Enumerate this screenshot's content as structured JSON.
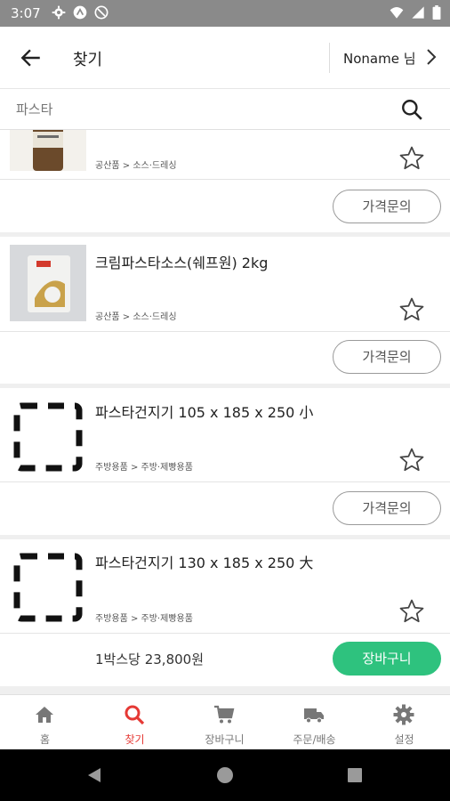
{
  "status_bar": {
    "time": "3:07"
  },
  "app_bar": {
    "title": "찾기",
    "user_label": "Noname 님"
  },
  "search": {
    "placeholder": "파스타",
    "value": ""
  },
  "products": [
    {
      "name": "",
      "category": "공산품 > 소스·드레싱",
      "action": "가격문의",
      "thumb": "photo-bottle"
    },
    {
      "name": "크림파스타소스(쉐프원) 2kg",
      "category": "공산품 > 소스·드레싱",
      "action": "가격문의",
      "thumb": "photo-package"
    },
    {
      "name": "파스타건지기 105 x 185 x 250 小",
      "category": "주방용품 > 주방·제빵용품",
      "action": "가격문의",
      "thumb": "placeholder"
    },
    {
      "name": "파스타건지기 130 x 185 x 250 大",
      "category": "주방용품 > 주방·제빵용품",
      "price": "1박스당 23,800원",
      "action": "장바구니",
      "thumb": "placeholder"
    }
  ],
  "bottom_nav": [
    {
      "label": "홈",
      "icon": "home-icon"
    },
    {
      "label": "찾기",
      "icon": "search-icon",
      "active": true
    },
    {
      "label": "장바구니",
      "icon": "cart-icon"
    },
    {
      "label": "주문/배송",
      "icon": "truck-icon"
    },
    {
      "label": "설정",
      "icon": "gear-icon"
    }
  ],
  "colors": {
    "accent_red": "#e53935",
    "cart_green": "#2ec27e",
    "status_bar": "#8a8a8a"
  }
}
